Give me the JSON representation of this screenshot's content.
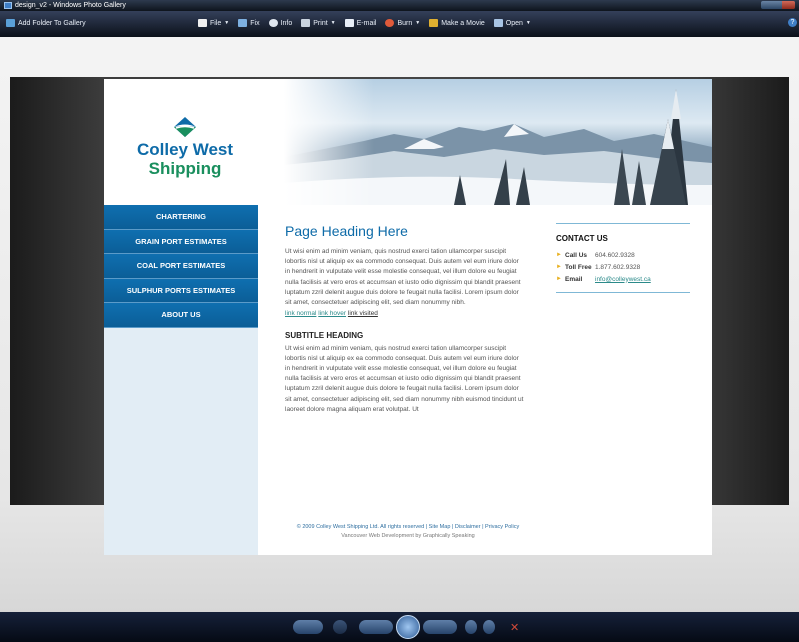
{
  "window": {
    "title": "design_v2 - Windows Photo Gallery"
  },
  "toolbar": {
    "add_folder": "Add Folder To Gallery",
    "items": [
      {
        "label": "File",
        "icon": "file-icon",
        "dropdown": true
      },
      {
        "label": "Fix",
        "icon": "fix-icon",
        "dropdown": false
      },
      {
        "label": "Info",
        "icon": "info-icon",
        "dropdown": false
      },
      {
        "label": "Print",
        "icon": "print-icon",
        "dropdown": true
      },
      {
        "label": "E-mail",
        "icon": "email-icon",
        "dropdown": false
      },
      {
        "label": "Burn",
        "icon": "burn-icon",
        "dropdown": true
      },
      {
        "label": "Make a Movie",
        "icon": "movie-icon",
        "dropdown": false
      },
      {
        "label": "Open",
        "icon": "open-icon",
        "dropdown": true
      }
    ]
  },
  "site": {
    "logo_line1": "Colley West",
    "logo_line2": "Shipping",
    "nav": [
      "CHARTERING",
      "GRAIN PORT ESTIMATES",
      "COAL PORT ESTIMATES",
      "SULPHUR PORTS ESTIMATES",
      "ABOUT US"
    ],
    "main": {
      "heading": "Page Heading Here",
      "paragraph1": "Ut wisi enim ad minim veniam, quis nostrud exerci tation ullamcorper suscipit lobortis nisl ut aliquip ex ea commodo consequat. Duis autem vel eum iriure dolor in hendrerit in vulputate velit esse molestie consequat, vel illum dolore eu feugiat nulla facilisis at vero eros et accumsan et iusto odio dignissim qui blandit praesent luptatum zzril delenit augue duis dolore te feugait nulla facilisi. Lorem ipsum dolor sit amet, consectetuer adipiscing elit, sed diam nonummy nibh.",
      "link_normal": "link normal",
      "link_hover": "link hover",
      "link_visited": "link visited",
      "subheading": "SUBTITLE HEADING",
      "paragraph2": "Ut wisi enim ad minim veniam, quis nostrud exerci tation ullamcorper suscipit lobortis nisl ut aliquip ex ea commodo consequat. Duis autem vel eum iriure dolor in hendrerit in vulputate velit esse molestie consequat, vel illum dolore eu feugiat nulla facilisis at vero eros et accumsan et iusto odio dignissim qui blandit praesent luptatum zzril delenit augue duis dolore te feugait nulla facilisi. Lorem ipsum dolor sit amet, consectetuer adipiscing elit, sed diam nonummy nibh euismod tincidunt ut laoreet dolore magna aliquam erat volutpat. Ut"
    },
    "contact": {
      "title": "CONTACT US",
      "call_label": "Call Us",
      "call_value": "604.602.9328",
      "tollfree_label": "Toll Free",
      "tollfree_value": "1.877.602.9328",
      "email_label": "Email",
      "email_value": "info@colleywest.ca"
    },
    "footer": {
      "line1": "© 2009 Colley West Shipping Ltd.  All rights reserved  |  Site Map  |  Disclaimer  |  Privacy Policy",
      "line2": "Vancouver Web Development by Graphically Speaking"
    }
  },
  "colors": {
    "brand_blue": "#0e6ba8",
    "brand_green": "#1a8f5e",
    "nav_blue": "#0f6fb0"
  }
}
